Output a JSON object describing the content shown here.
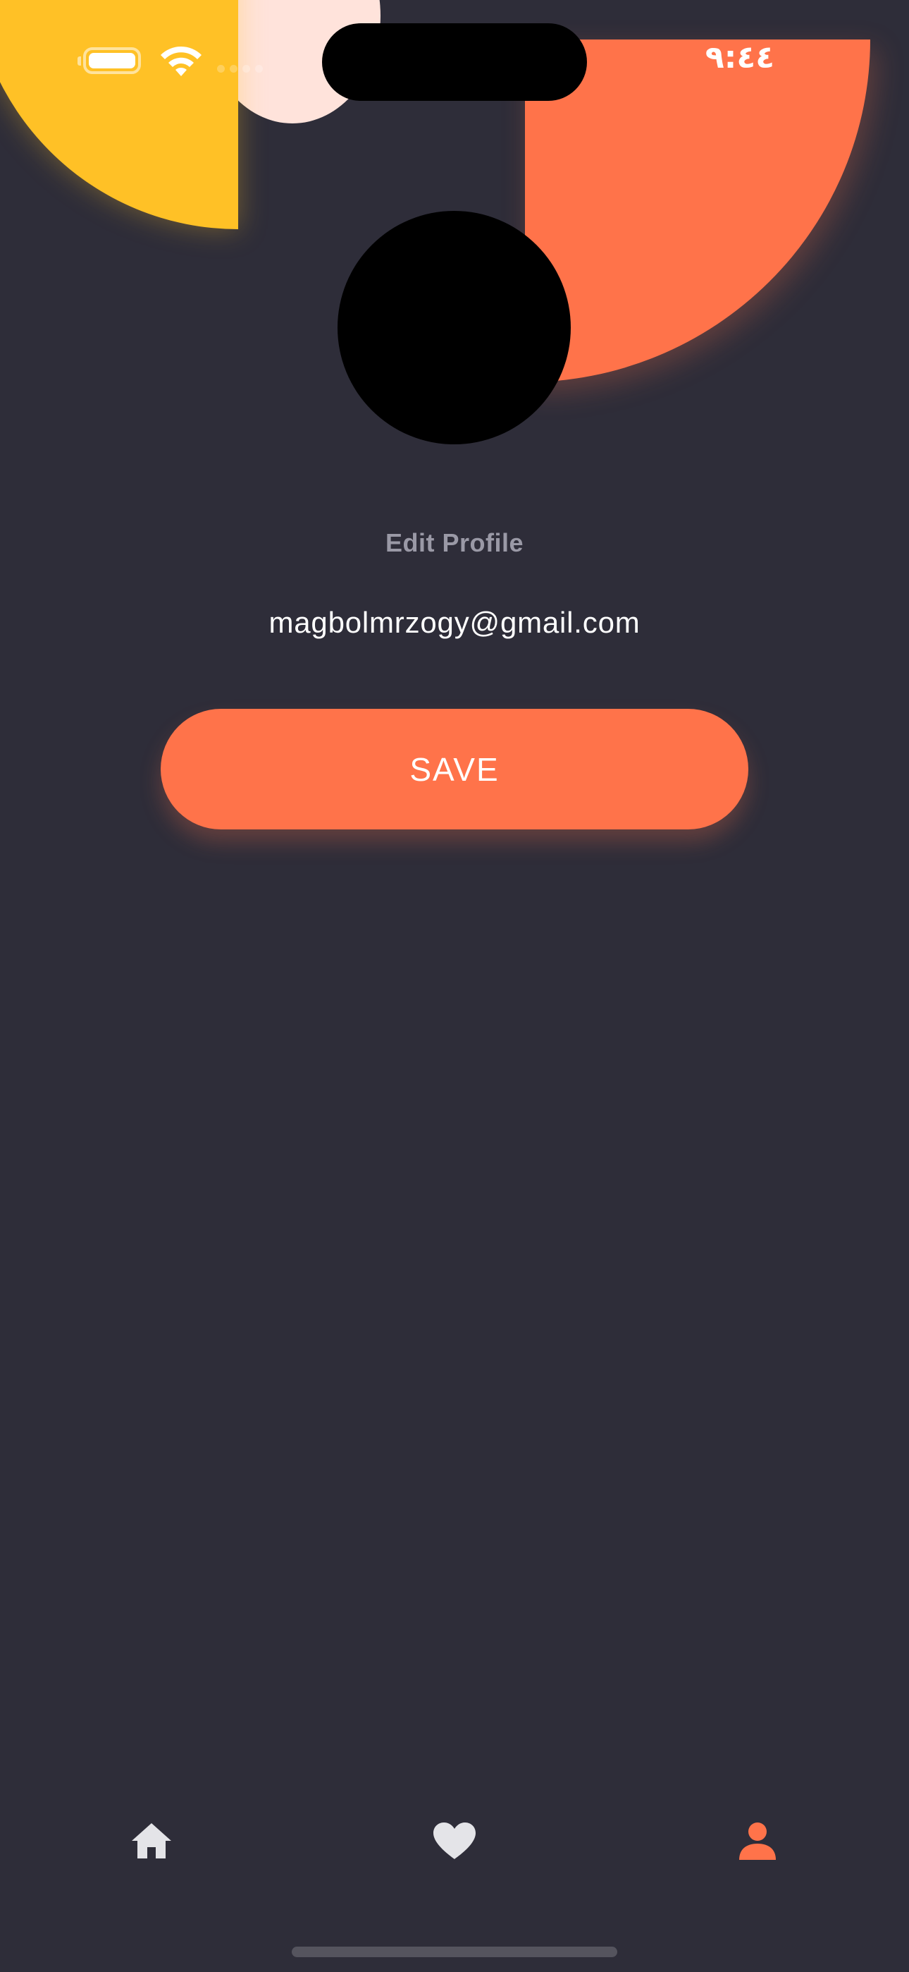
{
  "status_bar": {
    "time": "٩:٤٤",
    "battery_icon": "battery-icon",
    "wifi_icon": "wifi-icon",
    "signal_icon": "cellular-signal-icon"
  },
  "profile": {
    "heading": "Edit Profile",
    "email": "magbolmrzogy@gmail.com",
    "avatar": "avatar"
  },
  "actions": {
    "save_label": "SAVE"
  },
  "bottom_nav": {
    "items": [
      {
        "icon": "home-icon",
        "active": false
      },
      {
        "icon": "heart-icon",
        "active": false
      },
      {
        "icon": "person-icon",
        "active": true
      }
    ]
  },
  "colors": {
    "background": "#2e2d39",
    "accent": "#ff734a",
    "yellow": "#ffc126",
    "peach": "#ffe3db",
    "nav_inactive": "#e4e4e8",
    "muted_text": "#9a99a6"
  }
}
